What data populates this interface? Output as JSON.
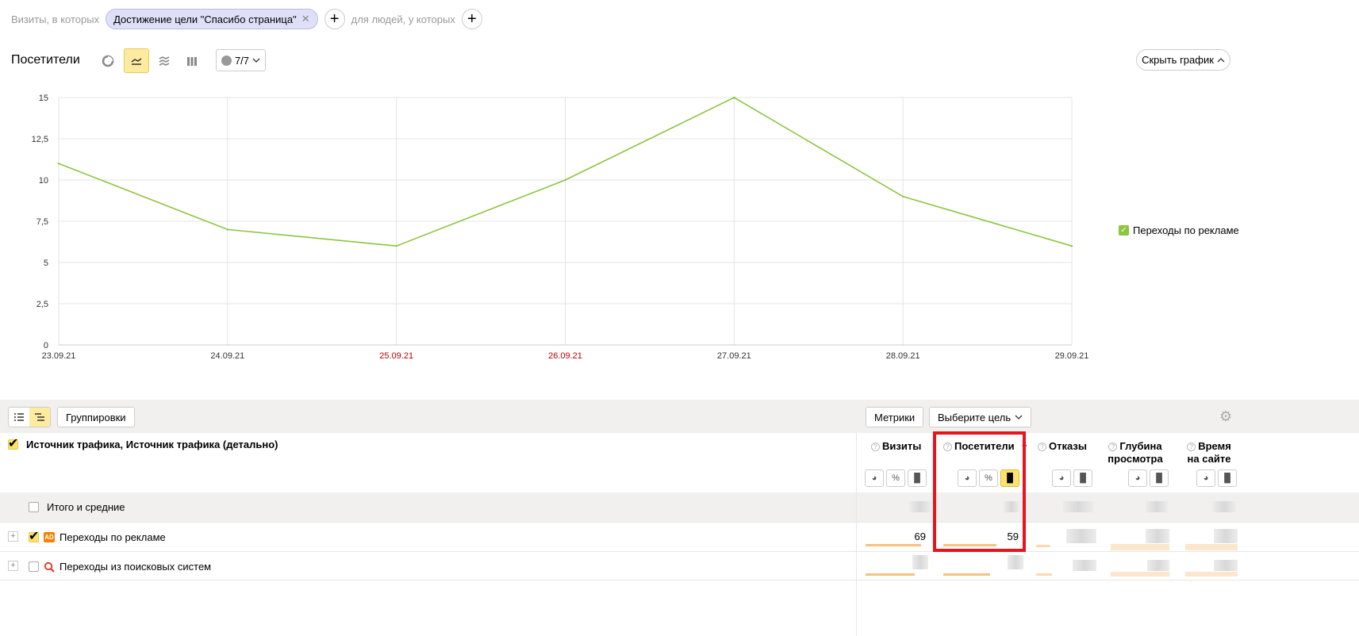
{
  "filter": {
    "prefix": "Визиты, в которых",
    "chip_label": "Достижение цели \"Спасибо страница\"",
    "chip_close": "✕",
    "add": "+",
    "people_text": "для людей, у которых"
  },
  "chart_header": {
    "title": "Посетители",
    "notes_label": "7/7",
    "hide_chart_label": "Скрыть график"
  },
  "chart_data": {
    "type": "line",
    "x": [
      "23.09.21",
      "24.09.21",
      "25.09.21",
      "26.09.21",
      "27.09.21",
      "28.09.21",
      "29.09.21"
    ],
    "weekend_x": [
      "25.09.21",
      "26.09.21"
    ],
    "series": [
      {
        "name": "Переходы по рекламе",
        "values": [
          11,
          7,
          6,
          10,
          15,
          9,
          6
        ],
        "color": "#8dc53f"
      }
    ],
    "yticks": [
      "0",
      "2,5",
      "5",
      "7,5",
      "10",
      "12,5",
      "15"
    ],
    "ylim": [
      0,
      15
    ],
    "grid": true,
    "legend_position": "right"
  },
  "table_toolbar": {
    "groupings_label": "Группировки",
    "metrics_label": "Метрики",
    "goal_select_label": "Выберите цель"
  },
  "table": {
    "dimension_header": "Источник трафика, Источник трафика (детально)",
    "columns": {
      "visits": "Визиты",
      "visitors": "Посетители",
      "bounces": "Отказы",
      "depth_line1": "Глубина",
      "depth_line2": "просмотра",
      "time_line1": "Время",
      "time_line2": "на сайте"
    },
    "sort_indicator": "▼",
    "total_label": "Итого и средние",
    "rows": [
      {
        "label": "Переходы по рекламе",
        "badge": "AD",
        "visits": "69",
        "visitors": "59",
        "visits_share": 0.9,
        "visitors_share": 0.86
      },
      {
        "label": "Переходы из поисковых систем",
        "visits_share": 0.8,
        "visitors_share": 0.75
      }
    ]
  },
  "colors": {
    "accent": "#ffeba0",
    "series": "#8dc53f",
    "weekend": "#c00000",
    "highlight": "#e8141b"
  }
}
